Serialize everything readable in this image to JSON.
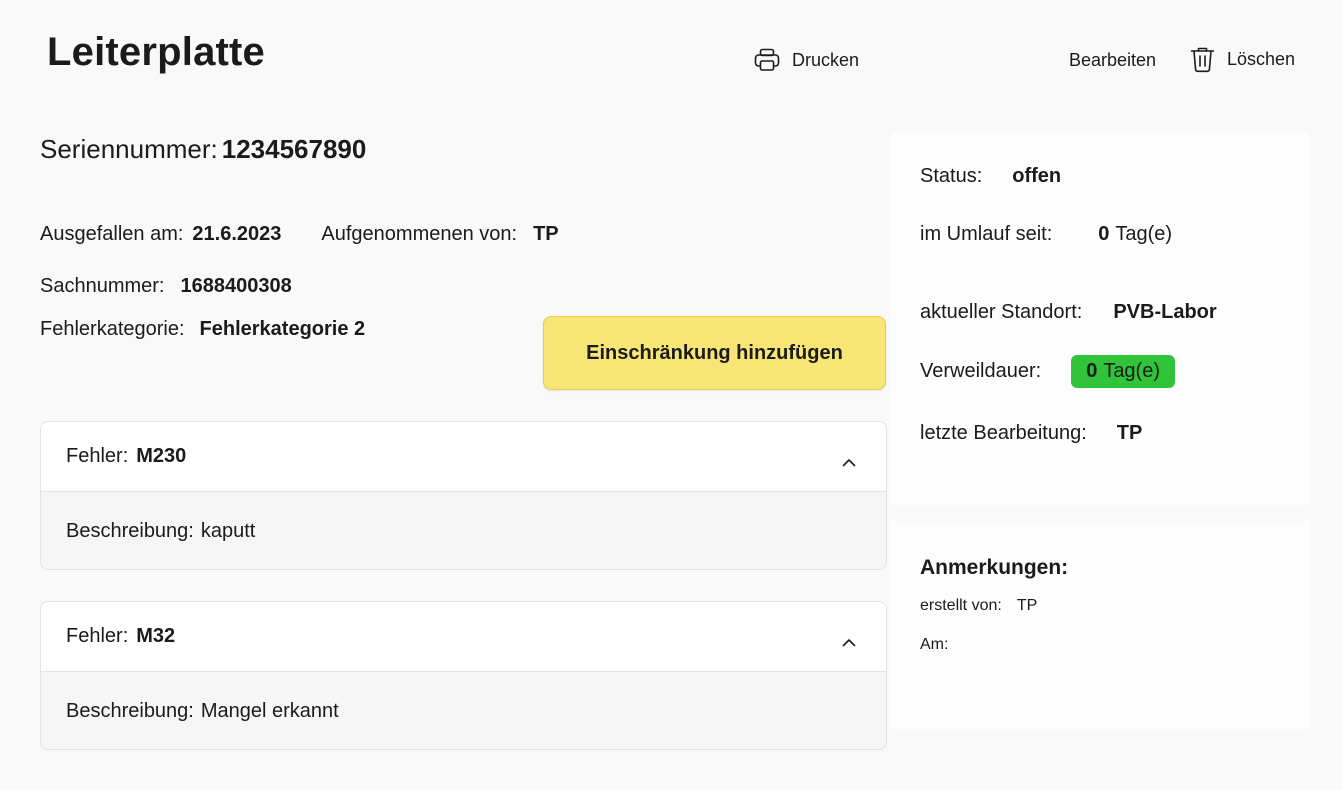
{
  "header": {
    "title": "Leiterplatte",
    "print_label": "Drucken",
    "edit_label": "Bearbeiten",
    "delete_label": "Löschen"
  },
  "details": {
    "serial_label": "Seriennummer:",
    "serial_value": "1234567890",
    "failed_label": "Ausgefallen am:",
    "failed_value": "21.6.2023",
    "recorded_label": "Aufgenommenen von:",
    "recorded_value": "TP",
    "part_label": "Sachnummer:",
    "part_value": "1688400308",
    "category_label": "Fehlerkategorie:",
    "category_value": "Fehlerkategorie 2",
    "restriction_button": "Einschränkung hinzufügen"
  },
  "errors": [
    {
      "label": "Fehler:",
      "code": "M230",
      "desc_label": "Beschreibung:",
      "desc": "kaputt"
    },
    {
      "label": "Fehler:",
      "code": "M32",
      "desc_label": "Beschreibung:",
      "desc": "Mangel erkannt"
    }
  ],
  "status_panel": {
    "status_label": "Status:",
    "status_value": "offen",
    "circulation_label": "im Umlauf seit:",
    "circulation_value": "0",
    "circulation_unit": "Tag(e)",
    "location_label": "aktueller Standort:",
    "location_value": "PVB-Labor",
    "dwell_label": "Verweildauer:",
    "dwell_value": "0",
    "dwell_unit": "Tag(e)",
    "dwell_color": "#31c43a",
    "last_edit_label": "letzte Bearbeitung:",
    "last_edit_value": "TP"
  },
  "notes": {
    "title": "Anmerkungen:",
    "created_by_label": "erstellt von:",
    "created_by_value": "TP",
    "date_label": "Am:"
  },
  "colors": {
    "restriction_button": "#f7e675",
    "background": "#f9f9f9"
  }
}
